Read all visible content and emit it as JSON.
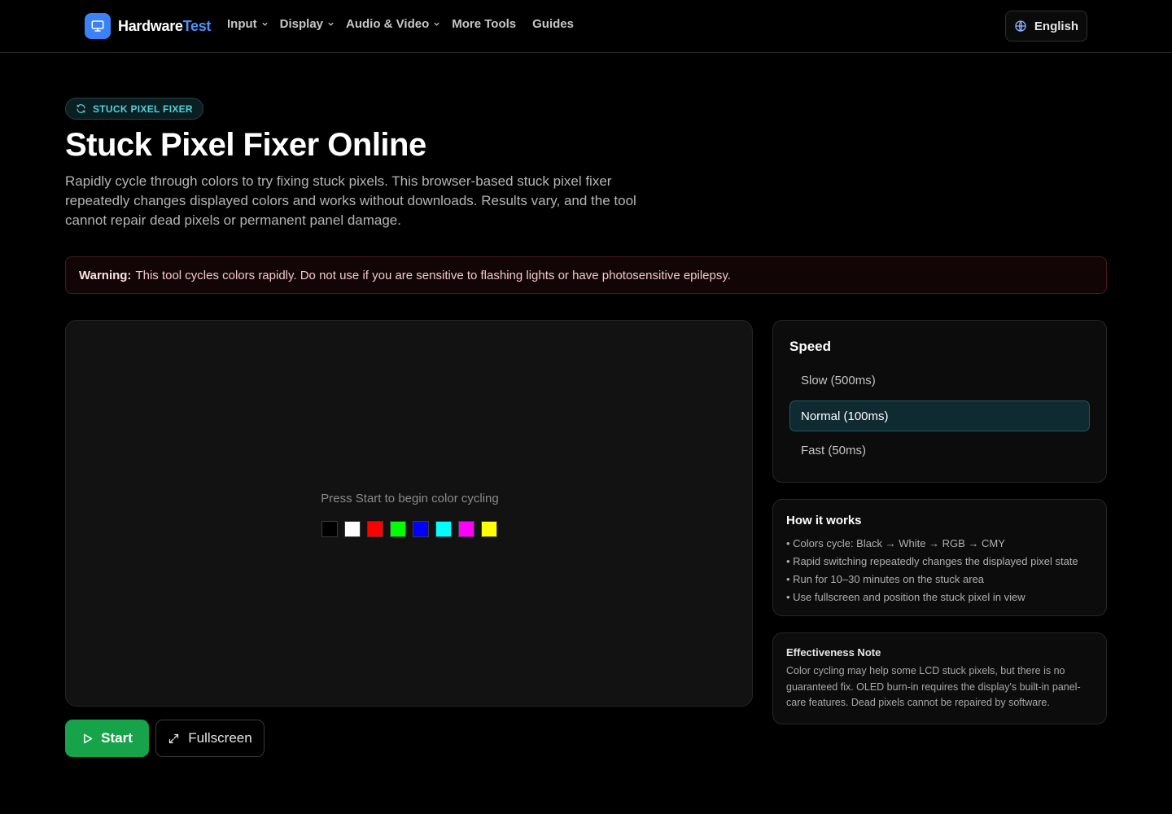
{
  "header": {
    "logo_part1": "Hardware",
    "logo_part2": "Test",
    "nav": [
      {
        "label": "Input",
        "has_dropdown": true
      },
      {
        "label": "Display",
        "has_dropdown": true
      },
      {
        "label": "Audio & Video",
        "has_dropdown": true
      },
      {
        "label": "More Tools",
        "has_dropdown": false
      },
      {
        "label": "Guides",
        "has_dropdown": false
      }
    ],
    "language": "English"
  },
  "hero": {
    "badge": "STUCK PIXEL FIXER",
    "title": "Stuck Pixel Fixer Online",
    "subtitle": "Rapidly cycle through colors to try fixing stuck pixels. This browser-based stuck pixel fixer repeatedly changes displayed colors and works without downloads. Results vary, and the tool cannot repair dead pixels or permanent panel damage."
  },
  "warning": {
    "label": "Warning:",
    "text": "This tool cycles colors rapidly. Do not use if you are sensitive to flashing lights or have photosensitive epilepsy."
  },
  "canvas": {
    "hint": "Press Start to begin color cycling",
    "swatches": [
      "#000000",
      "#ffffff",
      "#ff0000",
      "#00ff00",
      "#0000ff",
      "#00ffff",
      "#ff00ff",
      "#ffff00"
    ]
  },
  "controls": {
    "start_label": "Start",
    "fullscreen_label": "Fullscreen"
  },
  "speed": {
    "title": "Speed",
    "options": [
      "Slow (500ms)",
      "Normal (100ms)",
      "Fast (50ms)"
    ],
    "selected": "Normal (100ms)"
  },
  "how_it_works": {
    "title": "How it works",
    "items": [
      "• Colors cycle: Black → White → RGB → CMY",
      "• Rapid switching repeatedly changes the displayed pixel state",
      "• Run for 10–30 minutes on the stuck area",
      "• Use fullscreen and position the stuck pixel in view"
    ]
  },
  "effectiveness": {
    "title": "Effectiveness Note",
    "body": "Color cycling may help some LCD stuck pixels, but there is no guaranteed fix. OLED burn-in requires the display's built-in panel-care features. Dead pixels cannot be repaired by software."
  },
  "colors": {
    "accent_blue": "#3b82f6",
    "start_green": "#16a34a",
    "badge_cyan": "#4fd1d9"
  }
}
